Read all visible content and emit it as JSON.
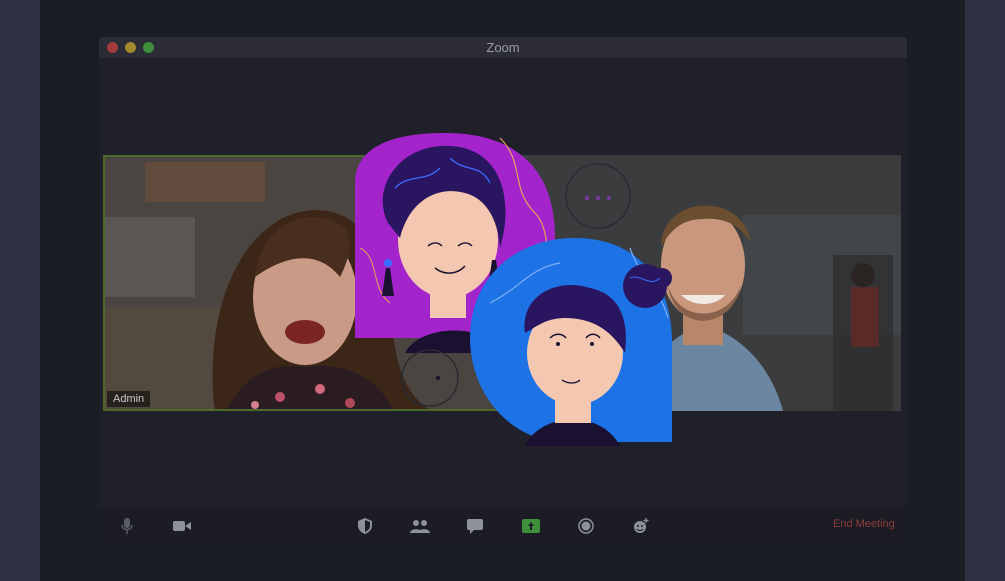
{
  "window": {
    "title": "Zoom"
  },
  "participants": [
    {
      "name": "Admin"
    },
    {
      "name": ""
    }
  ],
  "toolbar": {
    "icons": [
      "microphone-icon",
      "video-camera-icon",
      "security-shield-icon",
      "participants-icon",
      "chat-icon",
      "share-screen-icon",
      "record-icon",
      "reactions-icon"
    ],
    "end_label": "End Meeting"
  },
  "colors": {
    "background": "#1b1d25",
    "active_speaker_border": "#4d6a2b",
    "share_green": "#3f8e3c",
    "end_red": "#8d3a3a",
    "illustration_purple": "#a424cc",
    "illustration_blue": "#1d72e6"
  }
}
